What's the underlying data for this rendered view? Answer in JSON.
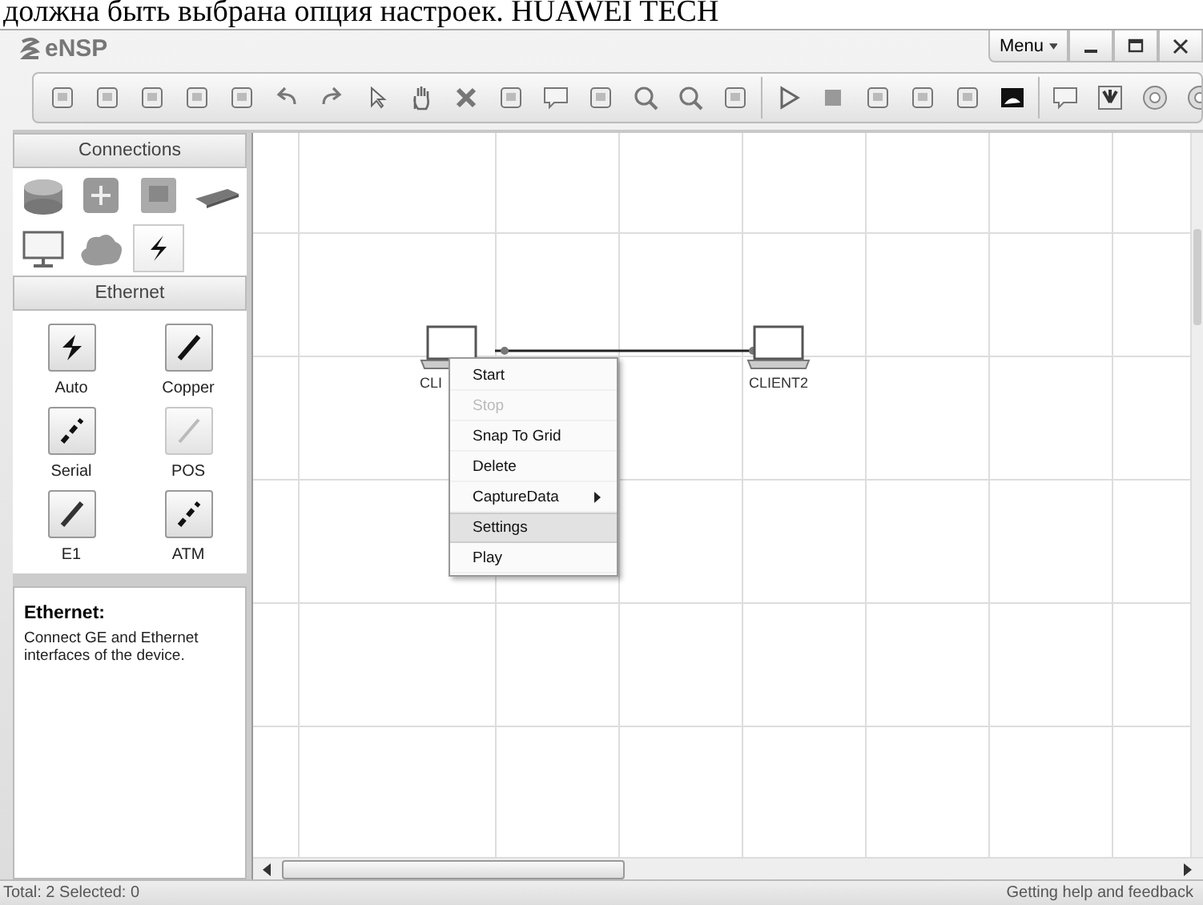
{
  "document_text": "должна быть выбрана опция настроек. HUAWEI TECH",
  "window": {
    "title": "eNSP",
    "menu": "Menu"
  },
  "left_panel": {
    "header": "Connections",
    "categories": [
      {
        "kind": "router",
        "selected": false
      },
      {
        "kind": "switch",
        "selected": false
      },
      {
        "kind": "wlan",
        "selected": false
      },
      {
        "kind": "firewall",
        "selected": false
      },
      {
        "kind": "pc",
        "selected": false
      },
      {
        "kind": "cloud",
        "selected": false
      },
      {
        "kind": "connection",
        "selected": true
      }
    ],
    "section": "Ethernet",
    "cables": [
      {
        "label": "Auto",
        "kind": "auto",
        "disabled": false
      },
      {
        "label": "Copper",
        "kind": "copper",
        "disabled": false
      },
      {
        "label": "Serial",
        "kind": "serial",
        "disabled": false
      },
      {
        "label": "POS",
        "kind": "pos",
        "disabled": true
      },
      {
        "label": "E1",
        "kind": "e1",
        "disabled": false
      },
      {
        "label": "ATM",
        "kind": "atm",
        "disabled": false
      }
    ],
    "description": {
      "title": "Ethernet:",
      "text": "Connect GE and Ethernet interfaces of the device."
    }
  },
  "canvas": {
    "devices": [
      {
        "label": "CLI"
      },
      {
        "label": "CLIENT2"
      }
    ],
    "context_menu": [
      {
        "label": "Start",
        "disabled": false,
        "selected": false,
        "submenu": false
      },
      {
        "label": "Stop",
        "disabled": true,
        "selected": false,
        "submenu": false
      },
      {
        "label": "Snap To Grid",
        "disabled": false,
        "selected": false,
        "submenu": false
      },
      {
        "label": "Delete",
        "disabled": false,
        "selected": false,
        "submenu": false
      },
      {
        "label": "CaptureData",
        "disabled": false,
        "selected": false,
        "submenu": true
      },
      {
        "label": "Settings",
        "disabled": false,
        "selected": true,
        "submenu": false
      },
      {
        "label": "Play",
        "disabled": false,
        "selected": false,
        "submenu": false
      }
    ]
  },
  "status_bar": {
    "left": "Total: 2  Selected: 0",
    "right": "Getting help and feedback"
  }
}
